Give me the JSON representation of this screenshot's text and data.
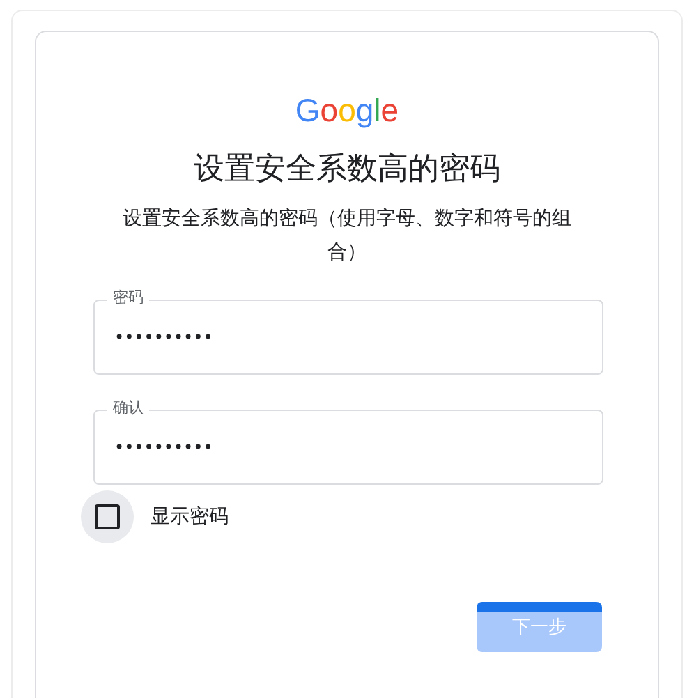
{
  "logo": "Google",
  "title": "设置安全系数高的密码",
  "subtitle": "设置安全系数高的密码（使用字母、数字和符号的组合）",
  "fields": [
    {
      "label": "密码",
      "value": "••••••••••"
    },
    {
      "label": "确认",
      "value": "••••••••••"
    }
  ],
  "show_password": {
    "label": "显示密码",
    "checked": false
  },
  "next_button": "下一步"
}
